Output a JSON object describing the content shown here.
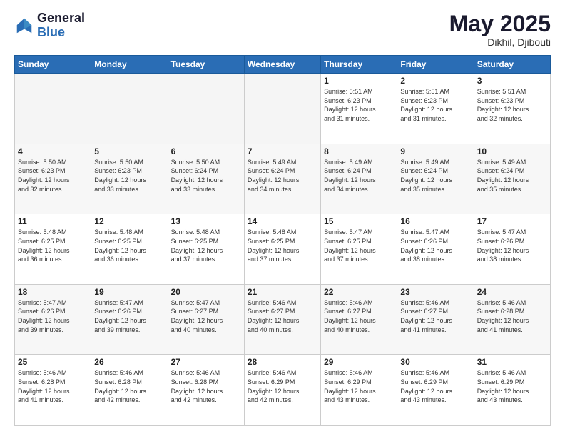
{
  "logo": {
    "line1": "General",
    "line2": "Blue"
  },
  "header": {
    "month": "May 2025",
    "location": "Dikhil, Djibouti"
  },
  "weekdays": [
    "Sunday",
    "Monday",
    "Tuesday",
    "Wednesday",
    "Thursday",
    "Friday",
    "Saturday"
  ],
  "weeks": [
    [
      {
        "day": "",
        "info": ""
      },
      {
        "day": "",
        "info": ""
      },
      {
        "day": "",
        "info": ""
      },
      {
        "day": "",
        "info": ""
      },
      {
        "day": "1",
        "info": "Sunrise: 5:51 AM\nSunset: 6:23 PM\nDaylight: 12 hours\nand 31 minutes."
      },
      {
        "day": "2",
        "info": "Sunrise: 5:51 AM\nSunset: 6:23 PM\nDaylight: 12 hours\nand 31 minutes."
      },
      {
        "day": "3",
        "info": "Sunrise: 5:51 AM\nSunset: 6:23 PM\nDaylight: 12 hours\nand 32 minutes."
      }
    ],
    [
      {
        "day": "4",
        "info": "Sunrise: 5:50 AM\nSunset: 6:23 PM\nDaylight: 12 hours\nand 32 minutes."
      },
      {
        "day": "5",
        "info": "Sunrise: 5:50 AM\nSunset: 6:23 PM\nDaylight: 12 hours\nand 33 minutes."
      },
      {
        "day": "6",
        "info": "Sunrise: 5:50 AM\nSunset: 6:24 PM\nDaylight: 12 hours\nand 33 minutes."
      },
      {
        "day": "7",
        "info": "Sunrise: 5:49 AM\nSunset: 6:24 PM\nDaylight: 12 hours\nand 34 minutes."
      },
      {
        "day": "8",
        "info": "Sunrise: 5:49 AM\nSunset: 6:24 PM\nDaylight: 12 hours\nand 34 minutes."
      },
      {
        "day": "9",
        "info": "Sunrise: 5:49 AM\nSunset: 6:24 PM\nDaylight: 12 hours\nand 35 minutes."
      },
      {
        "day": "10",
        "info": "Sunrise: 5:49 AM\nSunset: 6:24 PM\nDaylight: 12 hours\nand 35 minutes."
      }
    ],
    [
      {
        "day": "11",
        "info": "Sunrise: 5:48 AM\nSunset: 6:25 PM\nDaylight: 12 hours\nand 36 minutes."
      },
      {
        "day": "12",
        "info": "Sunrise: 5:48 AM\nSunset: 6:25 PM\nDaylight: 12 hours\nand 36 minutes."
      },
      {
        "day": "13",
        "info": "Sunrise: 5:48 AM\nSunset: 6:25 PM\nDaylight: 12 hours\nand 37 minutes."
      },
      {
        "day": "14",
        "info": "Sunrise: 5:48 AM\nSunset: 6:25 PM\nDaylight: 12 hours\nand 37 minutes."
      },
      {
        "day": "15",
        "info": "Sunrise: 5:47 AM\nSunset: 6:25 PM\nDaylight: 12 hours\nand 37 minutes."
      },
      {
        "day": "16",
        "info": "Sunrise: 5:47 AM\nSunset: 6:26 PM\nDaylight: 12 hours\nand 38 minutes."
      },
      {
        "day": "17",
        "info": "Sunrise: 5:47 AM\nSunset: 6:26 PM\nDaylight: 12 hours\nand 38 minutes."
      }
    ],
    [
      {
        "day": "18",
        "info": "Sunrise: 5:47 AM\nSunset: 6:26 PM\nDaylight: 12 hours\nand 39 minutes."
      },
      {
        "day": "19",
        "info": "Sunrise: 5:47 AM\nSunset: 6:26 PM\nDaylight: 12 hours\nand 39 minutes."
      },
      {
        "day": "20",
        "info": "Sunrise: 5:47 AM\nSunset: 6:27 PM\nDaylight: 12 hours\nand 40 minutes."
      },
      {
        "day": "21",
        "info": "Sunrise: 5:46 AM\nSunset: 6:27 PM\nDaylight: 12 hours\nand 40 minutes."
      },
      {
        "day": "22",
        "info": "Sunrise: 5:46 AM\nSunset: 6:27 PM\nDaylight: 12 hours\nand 40 minutes."
      },
      {
        "day": "23",
        "info": "Sunrise: 5:46 AM\nSunset: 6:27 PM\nDaylight: 12 hours\nand 41 minutes."
      },
      {
        "day": "24",
        "info": "Sunrise: 5:46 AM\nSunset: 6:28 PM\nDaylight: 12 hours\nand 41 minutes."
      }
    ],
    [
      {
        "day": "25",
        "info": "Sunrise: 5:46 AM\nSunset: 6:28 PM\nDaylight: 12 hours\nand 41 minutes."
      },
      {
        "day": "26",
        "info": "Sunrise: 5:46 AM\nSunset: 6:28 PM\nDaylight: 12 hours\nand 42 minutes."
      },
      {
        "day": "27",
        "info": "Sunrise: 5:46 AM\nSunset: 6:28 PM\nDaylight: 12 hours\nand 42 minutes."
      },
      {
        "day": "28",
        "info": "Sunrise: 5:46 AM\nSunset: 6:29 PM\nDaylight: 12 hours\nand 42 minutes."
      },
      {
        "day": "29",
        "info": "Sunrise: 5:46 AM\nSunset: 6:29 PM\nDaylight: 12 hours\nand 43 minutes."
      },
      {
        "day": "30",
        "info": "Sunrise: 5:46 AM\nSunset: 6:29 PM\nDaylight: 12 hours\nand 43 minutes."
      },
      {
        "day": "31",
        "info": "Sunrise: 5:46 AM\nSunset: 6:29 PM\nDaylight: 12 hours\nand 43 minutes."
      }
    ]
  ]
}
